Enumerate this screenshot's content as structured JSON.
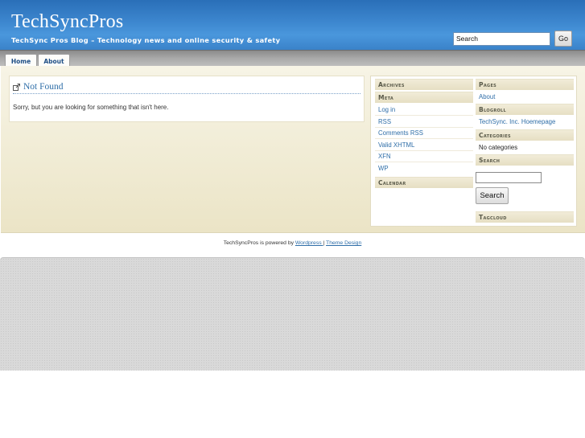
{
  "header": {
    "site_title": "TechSyncPros",
    "tagline": "TechSync Pros Blog – Technology news and online security & safety",
    "search_value": "Search",
    "go_label": "Go"
  },
  "nav": {
    "tabs": [
      {
        "label": "Home"
      },
      {
        "label": "About"
      }
    ]
  },
  "post": {
    "title": "Not Found",
    "text": "Sorry, but you are looking for something that isn't here."
  },
  "sidebar": {
    "archives": {
      "heading": "Archives"
    },
    "meta": {
      "heading": "Meta",
      "links": [
        "Log in",
        "RSS",
        "Comments RSS",
        "Valid XHTML",
        "XFN",
        "WP"
      ]
    },
    "calendar": {
      "heading": "Calendar"
    },
    "pages": {
      "heading": "Pages",
      "links": [
        "About"
      ]
    },
    "blogroll": {
      "heading": "Blogroll",
      "links": [
        "TechSync. Inc. Hoemepage"
      ]
    },
    "categories": {
      "heading": "Categories",
      "text": "No categories"
    },
    "search": {
      "heading": "Search",
      "button_label": "Search"
    },
    "tagcloud": {
      "heading": "Tagcloud"
    }
  },
  "footer": {
    "prefix": "TechSyncPros is powered by ",
    "wordpress_link": "Wordpress ",
    "separator": " | ",
    "theme_link": "Theme Design"
  },
  "colors": {
    "header_blue": "#3d87cf",
    "link_blue": "#2f6ea8",
    "content_beige": "#f0ebd3"
  }
}
